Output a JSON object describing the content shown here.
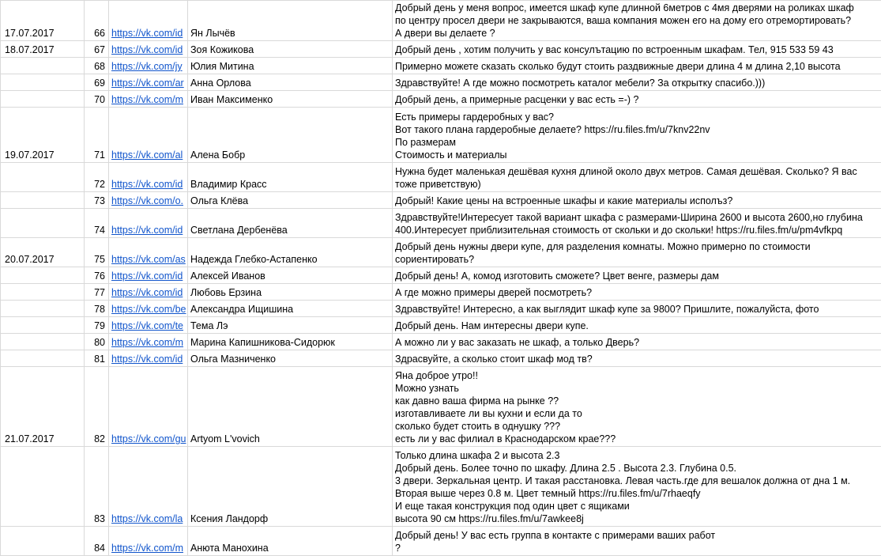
{
  "rows": [
    {
      "date": "17.07.2017",
      "num": "66",
      "link": "https://vk.com/id",
      "name": "Ян Лычёв",
      "msg": "Добрый день у меня вопрос, имеется шкаф купе длинной 6метров с 4мя дверями на роликах шкаф\nпо центру просел двери не закрываются, ваша компания можен его на дому его отремортировать?\nА двери вы делаете ?"
    },
    {
      "date": "18.07.2017",
      "num": "67",
      "link": "https://vk.com/id",
      "name": "Зоя Кожикова",
      "msg": "Добрый день , хотим получить у вас консулътацию по встроенным шкафам. Тел,  915 533 59 43"
    },
    {
      "date": "",
      "num": "68",
      "link": "https://vk.com/jy",
      "name": "Юлия Митина",
      "msg": "Примерно можете сказать сколько будут стоить раздвижные двери длина 4 м длина 2,10 высота"
    },
    {
      "date": "",
      "num": "69",
      "link": "https://vk.com/ar",
      "name": "Анна Орлова",
      "msg": "Здравствуйте! А где можно посмотреть каталог мебели? За открытку спасибо.)))"
    },
    {
      "date": "",
      "num": "70",
      "link": "https://vk.com/m",
      "name": "Иван Максименко",
      "msg": "Добрый день, а примерные расценки у вас есть =-) ?"
    },
    {
      "date": "19.07.2017",
      "num": "71",
      "link": "https://vk.com/al",
      "name": "Алена Бобр",
      "msg": "Есть примеры гардеробных у вас?\nВот такого плана гардеробные делаете? https://ru.files.fm/u/7knv22nv\nПо размерам\nСтоимость и материалы"
    },
    {
      "date": "",
      "num": "72",
      "link": "https://vk.com/id",
      "name": "Владимир Красс",
      "msg": "Нужна будет маленькая дешёвая кухня длиной около двух метров. Самая дешёвая. Сколько? Я вас\nтоже приветствую)"
    },
    {
      "date": "",
      "num": "73",
      "link": "https://vk.com/o.",
      "name": "Ольга Клёва",
      "msg": "Добрый! Какие цены на встроенные шкафы и какие материалы исполъз?"
    },
    {
      "date": "",
      "num": "74",
      "link": "https://vk.com/id",
      "name": "Светлана Дербенёва",
      "msg": "Здравствуйте!Интересует такой вариант шкафа с размерами-Ширина 2600 и высота 2600,но глубина\n400.Интересует приблизительная стоимость от скольки и до скольки! https://ru.files.fm/u/pm4vfkpq"
    },
    {
      "date": "20.07.2017",
      "num": "75",
      "link": "https://vk.com/as",
      "name": "Надежда Глебко-Астапенко",
      "msg": "Добрый день нужны двери купе, для разделения комнаты. Можно примерно по стоимости\nсориентировать?"
    },
    {
      "date": "",
      "num": "76",
      "link": "https://vk.com/id",
      "name": "Алексей Иванов",
      "msg": "Добрый день! А, комод изготовить сможете? Цвет венге, размеры дам"
    },
    {
      "date": "",
      "num": "77",
      "link": "https://vk.com/id",
      "name": "Любовь Ерзина",
      "msg": "А где можно примеры дверей посмотреть?"
    },
    {
      "date": "",
      "num": "78",
      "link": "https://vk.com/be",
      "name": "Александра Ищишина",
      "msg": "Здравствуйте! Интересно, а как выглядит шкаф купе за 9800? Пришлите, пожалуйста, фото"
    },
    {
      "date": "",
      "num": "79",
      "link": "https://vk.com/te",
      "name": "Тема Лэ",
      "msg": "Добрый день. Нам интересны двери купе."
    },
    {
      "date": "",
      "num": "80",
      "link": "https://vk.com/m",
      "name": "Марина Капишникова-Сидорюк",
      "msg": "А можно ли у вас заказать не шкаф, а только Дверь?"
    },
    {
      "date": "",
      "num": "81",
      "link": "https://vk.com/id",
      "name": "Ольга Мазниченко",
      "msg": "Здрасвуйте, а сколько стоит шкаф мод тв?"
    },
    {
      "date": "21.07.2017",
      "num": "82",
      "link": "https://vk.com/gu",
      "name": "Artyom L'vovich",
      "msg": "Яна доброе утро!!\nМожно узнать\nкак давно ваша фирма на рынке ??\nизготавливаете ли вы кухни и если да то\nсколько будет стоить в однушку ???\nесть ли у вас филиал в Краснодарском крае???"
    },
    {
      "date": "",
      "num": "83",
      "link": "https://vk.com/la",
      "name": "Ксения Ландорф",
      "msg": "Только длина шкафа 2 и высота 2.3\nДобрый день. Более точно по шкафу. Длина 2.5 . Высота 2.3. Глубина 0.5.\n3 двери. Зеркальная центр. И такая расстановка. Левая часть.где для вешалок должна от дна 1 м.\nВторая выше через 0.8 м. Цвет темный https://ru.files.fm/u/7rhaeqfy\nИ еще такая конструкция под один цвет с ящиками\nвысота 90 см https://ru.files.fm/u/7awkee8j"
    },
    {
      "date": "",
      "num": "84",
      "link": "https://vk.com/m",
      "name": "Анюта Манохина",
      "msg": "Добрый день! У вас есть группа в контакте с примерами ваших работ\n?"
    }
  ]
}
